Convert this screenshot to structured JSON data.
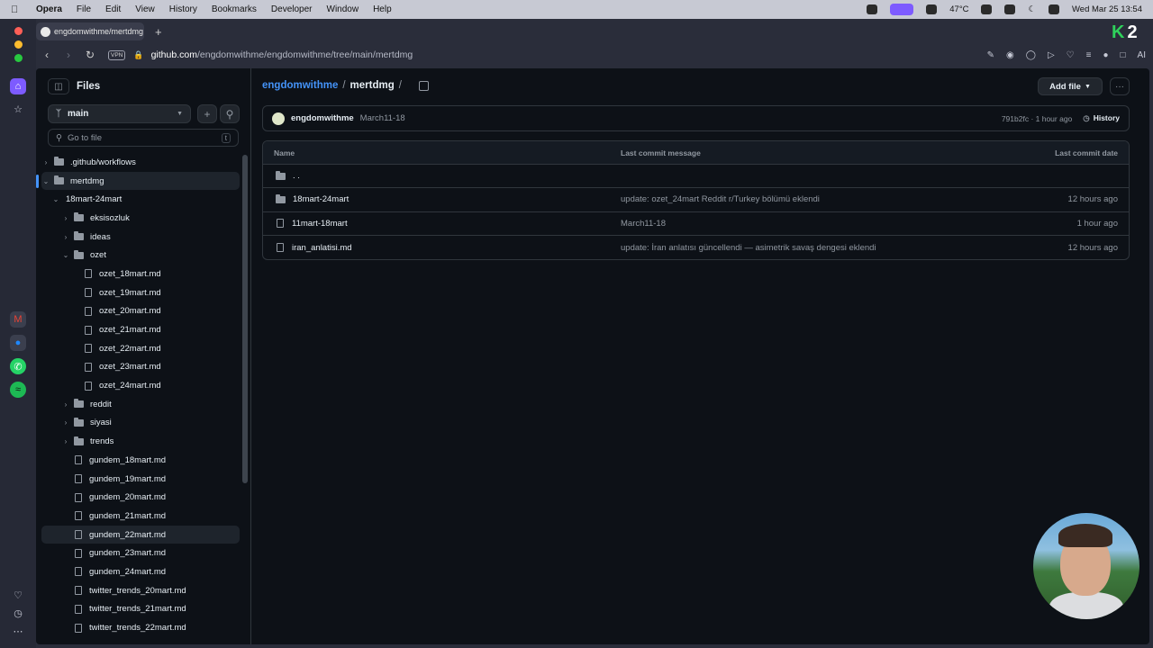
{
  "menubar": {
    "app": "Opera",
    "items": [
      "File",
      "Edit",
      "View",
      "History",
      "Bookmarks",
      "Developer",
      "Window",
      "Help"
    ],
    "temperature": "47°C",
    "datetime": "Wed Mar 25  13:54"
  },
  "browser": {
    "tab_title": "engdomwithme/mertdmg",
    "vpn_label": "VPN",
    "url_domain": "github.com",
    "url_path": "/engdomwithme/engdomwithme/tree/main/mertdmg",
    "ai_label": "AI"
  },
  "sidebar": {
    "title": "Files",
    "branch": "main",
    "search_placeholder": "Go to file",
    "search_shortcut": "t",
    "tree": [
      {
        "label": ".github/workflows",
        "type": "folder",
        "depth": 0,
        "expanded": false
      },
      {
        "label": "mertdmg",
        "type": "folder",
        "depth": 0,
        "expanded": true,
        "selected": true
      },
      {
        "label": "18mart-24mart",
        "type": "folder",
        "depth": 1,
        "expanded": true,
        "nofolder": true
      },
      {
        "label": "eksisozluk",
        "type": "folder",
        "depth": 2,
        "expanded": false
      },
      {
        "label": "ideas",
        "type": "folder",
        "depth": 2,
        "expanded": false
      },
      {
        "label": "ozet",
        "type": "folder",
        "depth": 2,
        "expanded": true
      },
      {
        "label": "ozet_18mart.md",
        "type": "file",
        "depth": 3
      },
      {
        "label": "ozet_19mart.md",
        "type": "file",
        "depth": 3
      },
      {
        "label": "ozet_20mart.md",
        "type": "file",
        "depth": 3
      },
      {
        "label": "ozet_21mart.md",
        "type": "file",
        "depth": 3
      },
      {
        "label": "ozet_22mart.md",
        "type": "file",
        "depth": 3
      },
      {
        "label": "ozet_23mart.md",
        "type": "file",
        "depth": 3
      },
      {
        "label": "ozet_24mart.md",
        "type": "file",
        "depth": 3
      },
      {
        "label": "reddit",
        "type": "folder",
        "depth": 2,
        "expanded": false
      },
      {
        "label": "siyasi",
        "type": "folder",
        "depth": 2,
        "expanded": false
      },
      {
        "label": "trends",
        "type": "folder",
        "depth": 2,
        "expanded": false
      },
      {
        "label": "gundem_18mart.md",
        "type": "file",
        "depth": 2
      },
      {
        "label": "gundem_19mart.md",
        "type": "file",
        "depth": 2
      },
      {
        "label": "gundem_20mart.md",
        "type": "file",
        "depth": 2
      },
      {
        "label": "gundem_21mart.md",
        "type": "file",
        "depth": 2
      },
      {
        "label": "gundem_22mart.md",
        "type": "file",
        "depth": 2,
        "highlighted": true
      },
      {
        "label": "gundem_23mart.md",
        "type": "file",
        "depth": 2
      },
      {
        "label": "gundem_24mart.md",
        "type": "file",
        "depth": 2
      },
      {
        "label": "twitter_trends_20mart.md",
        "type": "file",
        "depth": 2
      },
      {
        "label": "twitter_trends_21mart.md",
        "type": "file",
        "depth": 2
      },
      {
        "label": "twitter_trends_22mart.md",
        "type": "file",
        "depth": 2
      }
    ]
  },
  "main": {
    "breadcrumb_repo": "engdomwithme",
    "breadcrumb_sep": "/",
    "breadcrumb_folder": "mertdmg",
    "add_file_label": "Add file",
    "more_label": "···",
    "commit": {
      "author": "engdomwithme",
      "message": "March11-18",
      "meta": "791b2fc · 1 hour ago",
      "history_label": "History"
    },
    "table": {
      "headers": [
        "Name",
        "Last commit message",
        "Last commit date"
      ],
      "rows": [
        {
          "name": ". .",
          "type": "parent",
          "message": "",
          "date": ""
        },
        {
          "name": "18mart-24mart",
          "type": "folder",
          "message": "update: ozet_24mart Reddit r/Turkey bölümü eklendi",
          "date": "12 hours ago"
        },
        {
          "name": "11mart-18mart",
          "type": "file",
          "message": "March11-18",
          "date": "1 hour ago"
        },
        {
          "name": "iran_anlatisi.md",
          "type": "file",
          "message": "update: İran anlatısı güncellendi — asimetrik savaş dengesi eklendi",
          "date": "12 hours ago"
        }
      ]
    }
  },
  "colors": {
    "accent": "#4493f8",
    "background": "#0d1117",
    "border": "#30363d"
  }
}
